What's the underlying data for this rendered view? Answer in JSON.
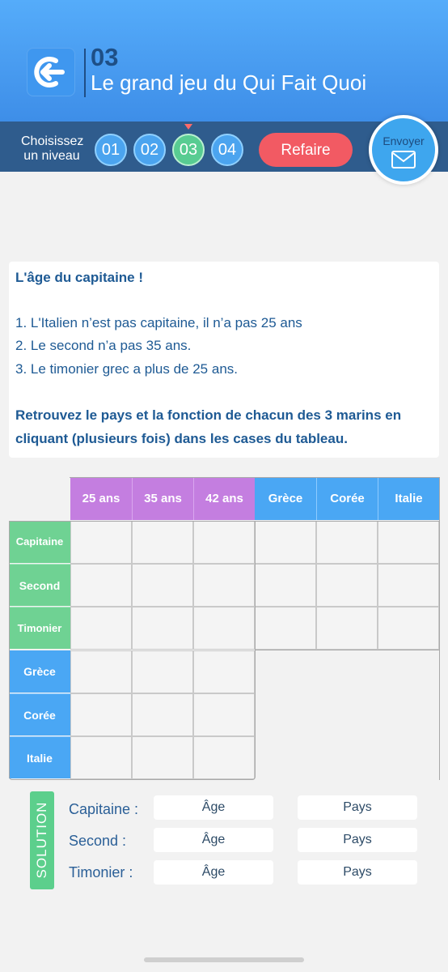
{
  "header": {
    "level_number": "03",
    "title": "Le grand jeu du Qui Fait Quoi"
  },
  "level_bar": {
    "choose_line1": "Choisissez",
    "choose_line2": "un niveau",
    "levels": [
      "01",
      "02",
      "03",
      "04"
    ],
    "active_level": "03",
    "refaire": "Refaire",
    "send": "Envoyer"
  },
  "puzzle": {
    "title": "L'âge du capitaine !",
    "clues": [
      "1. L'Italien n’est pas capitaine, il n’a pas 25 ans",
      "2. Le second n’a pas 35 ans.",
      "3. Le timonier grec a plus de 25 ans."
    ],
    "instruction": "Retrouvez le pays et la fonction de chacun des 3 marins en cliquant (plusieurs fois) dans les cases du tableau."
  },
  "grid": {
    "col_headers": [
      "25 ans",
      "35 ans",
      "42 ans",
      "Grèce",
      "Corée",
      "Italie"
    ],
    "row_headers": [
      "Capitaine",
      "Second",
      "Timonier",
      "Grèce",
      "Corée",
      "Italie"
    ],
    "colors": {
      "age": "#c47ee0",
      "country": "#4aa7f4",
      "role": "#6fd293"
    }
  },
  "solution": {
    "tag": "SOLUTION",
    "rows": [
      {
        "label": "Capitaine :",
        "age": "Âge",
        "country": "Pays"
      },
      {
        "label": "Second :",
        "age": "Âge",
        "country": "Pays"
      },
      {
        "label": "Timonier :",
        "age": "Âge",
        "country": "Pays"
      }
    ]
  }
}
